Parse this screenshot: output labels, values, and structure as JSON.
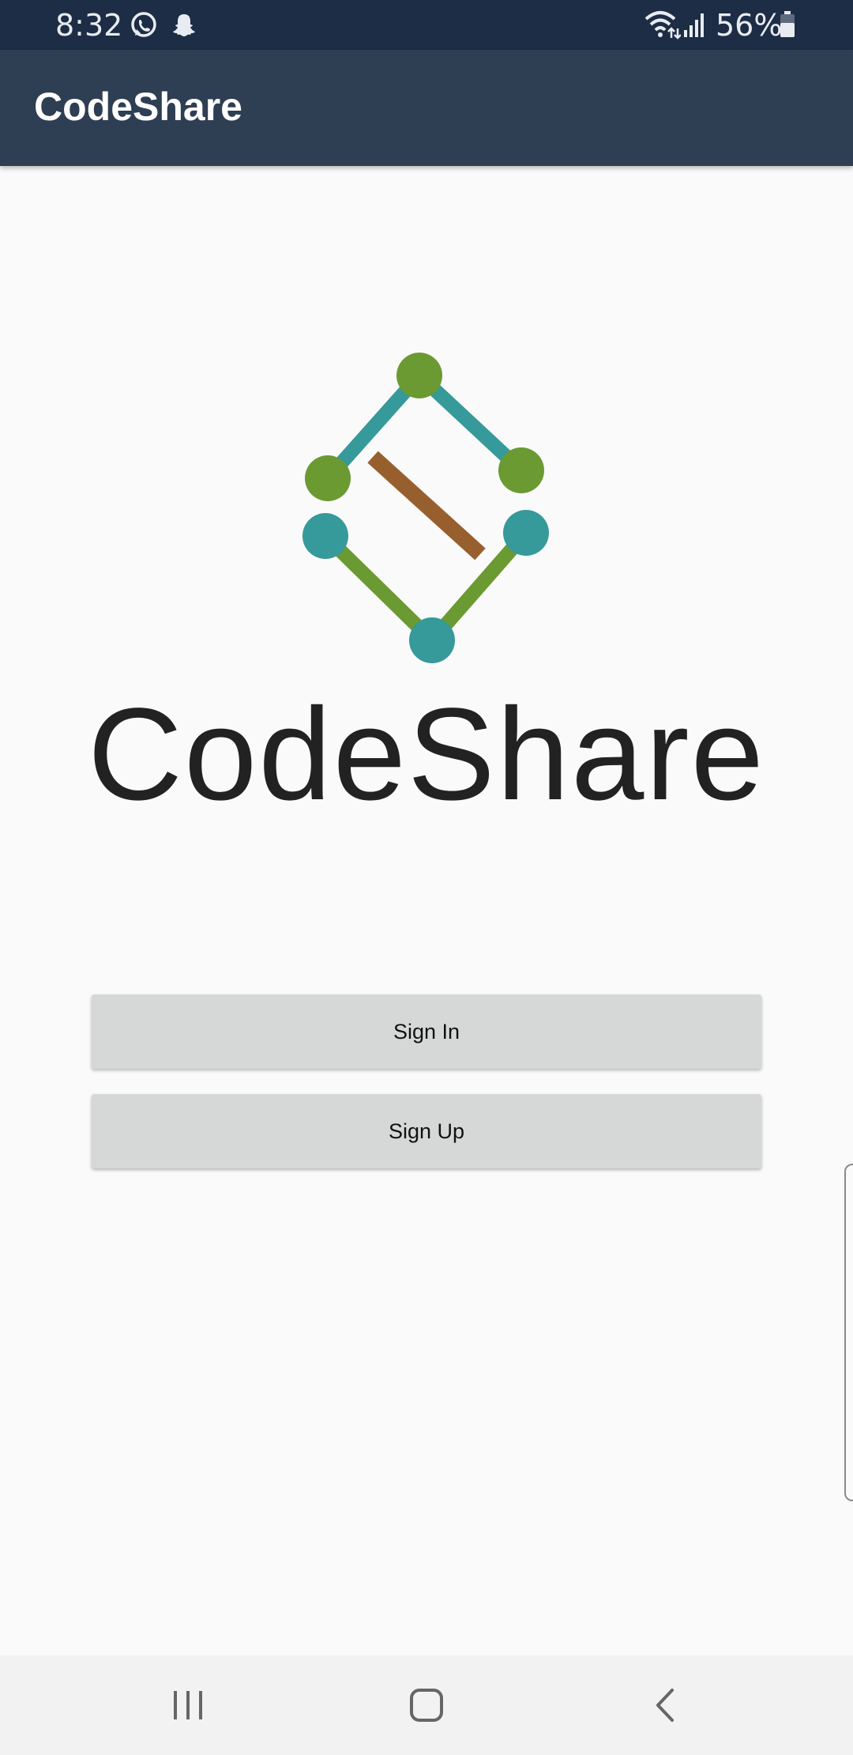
{
  "status_bar": {
    "time": "8:32",
    "battery_percent": "56%",
    "background_color": "#1c2d45",
    "icons": [
      "whatsapp-icon",
      "snapchat-icon",
      "wifi-icon",
      "signal-icon",
      "battery-icon"
    ]
  },
  "app_bar": {
    "title": "CodeShare",
    "background_color": "#2e3e53"
  },
  "logo": {
    "icon": "codeshare-logo-icon",
    "colors": {
      "teal": "#36999a",
      "green": "#6a9a31",
      "brown": "#985f2e"
    }
  },
  "brand": {
    "title": "CodeShare"
  },
  "buttons": {
    "sign_in": "Sign In",
    "sign_up": "Sign Up",
    "background_color": "#d6d7d7"
  },
  "nav_bar": {
    "icons": [
      "recent-apps-icon",
      "home-icon",
      "back-icon"
    ]
  }
}
